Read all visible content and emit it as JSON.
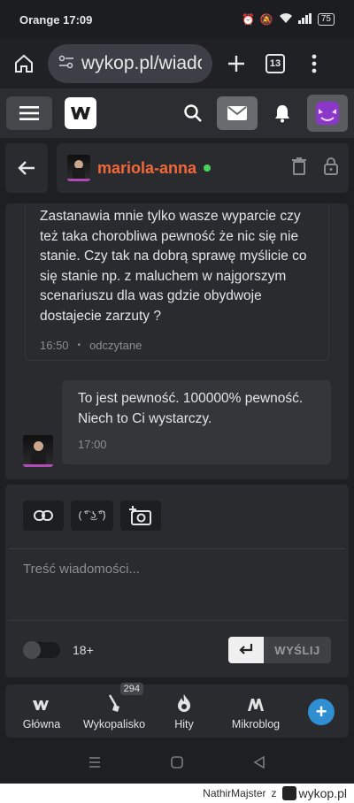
{
  "status_bar": {
    "carrier": "Orange",
    "time": "17:09",
    "battery": "75"
  },
  "browser": {
    "url": "wykop.pl/wiado",
    "tab_count": "13"
  },
  "conversation": {
    "username": "mariola-anna"
  },
  "messages": [
    {
      "text": "Zastanawia mnie tylko wasze wyparcie czy też taka chorobliwa pewność że nic się nie stanie. Czy tak na dobrą sprawę myślicie co się stanie np. z maluchem w najgorszym scenariuszu dla was gdzie obydwoje dostajecie zarzuty ?",
      "time": "16:50",
      "status": "odczytane"
    },
    {
      "text": "To jest pewność. 100000% pewność. Niech to Ci wystarczy.",
      "time": "17:00"
    }
  ],
  "composer": {
    "lenny_label": "( ͡° ͜ʖ ͡°)",
    "placeholder": "Treść wiadomości...",
    "adult_label": "18+",
    "send_label": "WYŚLIJ"
  },
  "bottom_nav": [
    {
      "label": "Główna"
    },
    {
      "label": "Wykopalisko",
      "badge": "294"
    },
    {
      "label": "Hity"
    },
    {
      "label": "Mikroblog"
    }
  ],
  "footer": {
    "author": "NathirMajster",
    "connector": "z",
    "brand": "wykop.pl"
  }
}
